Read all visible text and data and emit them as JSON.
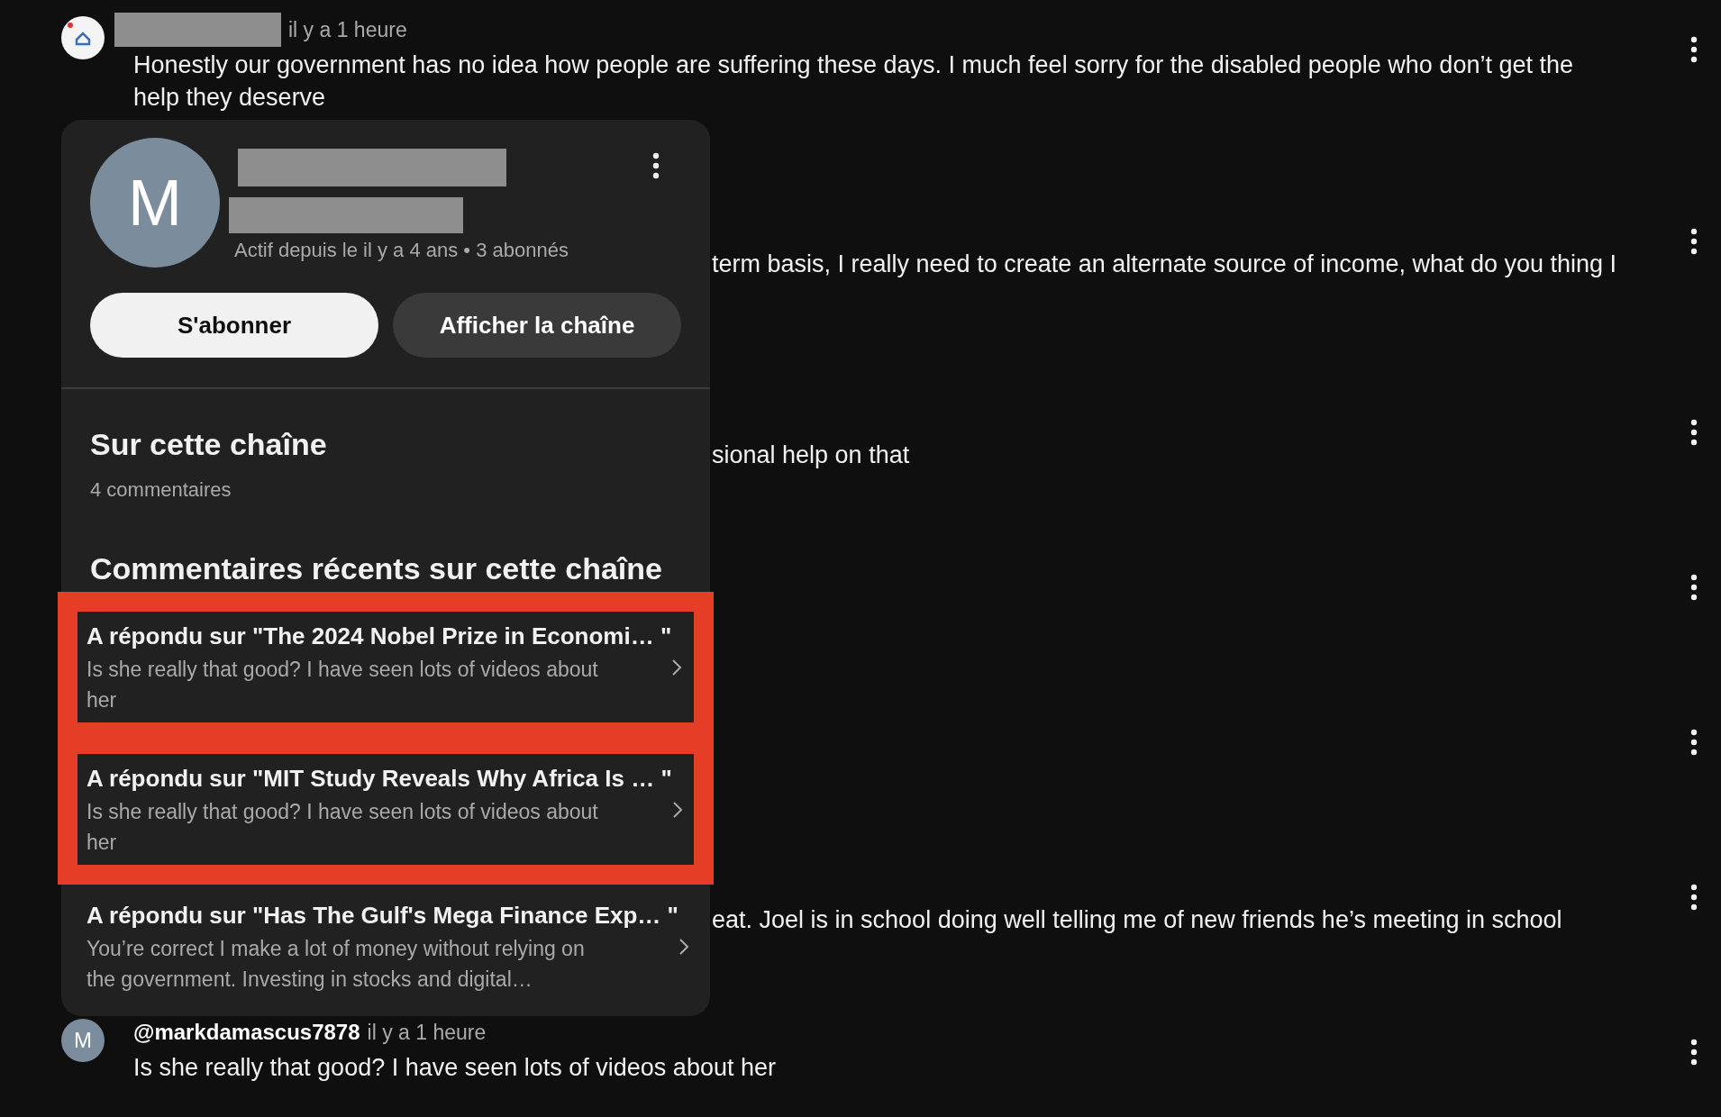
{
  "comments": [
    {
      "kind": "full",
      "author_redacted": true,
      "time": "il y a 1 heure",
      "avatar": {
        "kind": "logo"
      },
      "lines": [
        "Honestly our government has no idea how people are suffering these days. I much feel sorry for the disabled people who don’t get the",
        "help they deserve"
      ]
    },
    {
      "kind": "covered",
      "lines": [
        "term basis, I really need to create an alternate source of income, what do you thing I"
      ]
    },
    {
      "kind": "covered",
      "lines": [
        "sional help on that"
      ]
    },
    {
      "kind": "covered"
    },
    {
      "kind": "covered"
    },
    {
      "kind": "covered",
      "lines": [
        "eat. Joel is in school doing well telling me of new friends he’s meeting in school"
      ]
    },
    {
      "kind": "full",
      "author": "@markdamascus7878",
      "time": "il y a 1 heure",
      "avatar": {
        "kind": "letter",
        "letter": "M"
      },
      "lines": [
        "Is she really that good? I have seen lots of videos about her"
      ]
    }
  ],
  "profile_card": {
    "avatar_letter": "M",
    "meta": "Actif depuis le il y a 4 ans • 3 abonnés",
    "buttons": [
      {
        "label": "S'abonner",
        "kind": "primary"
      },
      {
        "label": "Afficher la chaîne",
        "kind": "secondary"
      }
    ],
    "section_title": "Sur cette chaîne",
    "comment_count": "4 commentaires",
    "recent_title": "Commentaires récents sur cette chaîne",
    "recent": [
      {
        "title": "A répondu sur \"The 2024 Nobel Prize in Economi… \"",
        "snippet": [
          "Is she really that good? I have seen lots of videos about",
          "her"
        ],
        "highlighted": true
      },
      {
        "title": "A répondu sur \"MIT Study Reveals Why Africa Is … \"",
        "snippet": [
          "Is she really that good? I have seen lots of videos about",
          "her"
        ],
        "highlighted": true
      },
      {
        "title": "A répondu sur \"Has The Gulf's Mega Finance Exp… \"",
        "snippet": [
          "You’re correct I make a lot of money without relying on",
          "the government. Investing in stocks and digital…"
        ],
        "highlighted": false
      }
    ]
  }
}
